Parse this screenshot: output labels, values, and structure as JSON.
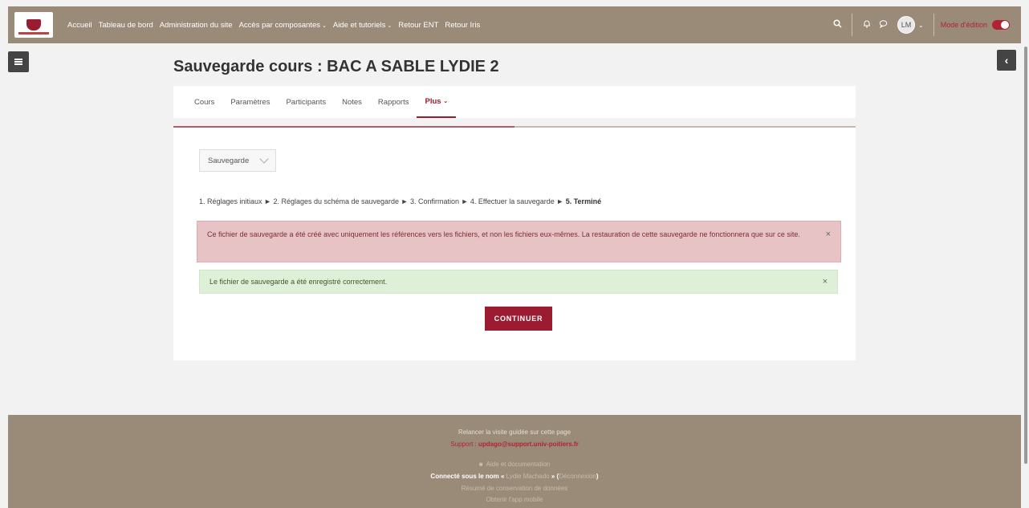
{
  "navbar": {
    "links": [
      {
        "label": "Accueil"
      },
      {
        "label": "Tableau de bord"
      },
      {
        "label": "Administration du site"
      },
      {
        "label": "Accès par composantes",
        "dropdown": true
      },
      {
        "label": "Aide et tutoriels",
        "dropdown": true
      },
      {
        "label": "Retour ENT"
      },
      {
        "label": "Retour Iris"
      }
    ],
    "avatar_initials": "LM",
    "edit_mode_label": "Mode d'édition",
    "icons": [
      "search-icon",
      "bell-icon",
      "chat-icon"
    ]
  },
  "page": {
    "title": "Sauvegarde cours : BAC A SABLE LYDIE 2"
  },
  "tabs": [
    {
      "label": "Cours"
    },
    {
      "label": "Paramètres"
    },
    {
      "label": "Participants"
    },
    {
      "label": "Notes"
    },
    {
      "label": "Rapports"
    },
    {
      "label": "Plus",
      "active": true
    }
  ],
  "select": {
    "value": "Sauvegarde"
  },
  "steps": {
    "prefix": "1. Réglages initiaux ► 2. Réglages du schéma de sauvegarde ► 3. Confirmation ► 4. Effectuer la sauvegarde ► ",
    "current": "5. Terminé"
  },
  "alerts": {
    "danger": "Ce fichier de sauvegarde a été créé avec uniquement les références vers les fichiers, et non les fichiers eux-mêmes. La restauration de cette sauvegarde ne fonctionnera que sur ce site.",
    "success": "Le fichier de sauvegarde a été enregistré correctement.",
    "close_glyph": "×"
  },
  "buttons": {
    "continue": "CONTINUER"
  },
  "footer": {
    "tour": "Relancer la visite guidée sur cette page",
    "support_prefix": "Support : ",
    "support_email": "updago@support.univ-poitiers.fr",
    "help": "Aide et documentation",
    "connected_prefix": "Connecté sous le nom « ",
    "user_name": "Lydie Machado",
    "connected_mid": " » (",
    "logout": "Déconnexion",
    "connected_suffix": ")",
    "data_retention": "Résumé de conservation de données",
    "mobile_app": "Obtenir l'app mobile"
  },
  "colors": {
    "brand": "#9b1b30",
    "navbar_bg": "#9a8b78",
    "danger_bg": "#e7c3c6",
    "success_bg": "#dff0d8"
  }
}
